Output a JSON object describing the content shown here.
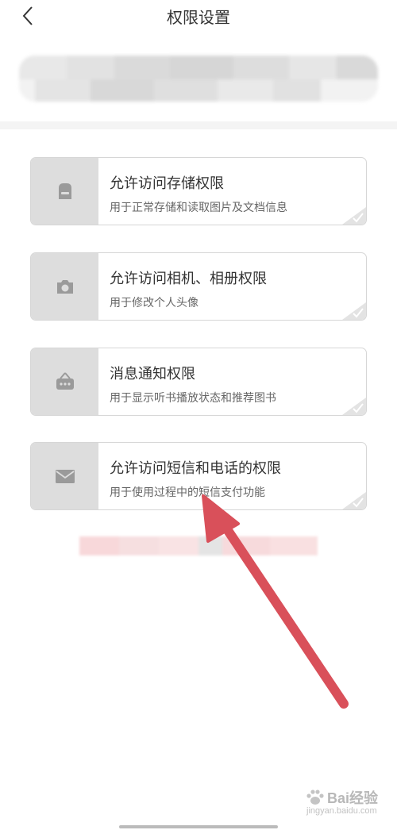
{
  "header": {
    "title": "权限设置",
    "back_icon": "chevron-left-icon"
  },
  "permissions": [
    {
      "icon": "storage-icon",
      "title": "允许访问存储权限",
      "desc": "用于正常存储和读取图片及文档信息",
      "granted": true
    },
    {
      "icon": "camera-icon",
      "title": "允许访问相机、相册权限",
      "desc": "用于修改个人头像",
      "granted": true
    },
    {
      "icon": "notification-icon",
      "title": "消息通知权限",
      "desc": "用于显示听书播放状态和推荐图书",
      "granted": true
    },
    {
      "icon": "mail-icon",
      "title": "允许访问短信和电话的权限",
      "desc": "用于使用过程中的短信支付功能",
      "granted": true
    }
  ],
  "watermark": {
    "brand": "Bai经验",
    "url": "jingyan.baidu.com"
  },
  "colors": {
    "icon_bg": "#dddddd",
    "icon_fg": "#9a9a9a",
    "arrow": "#d9505a",
    "card_border": "#d6d6d6"
  }
}
